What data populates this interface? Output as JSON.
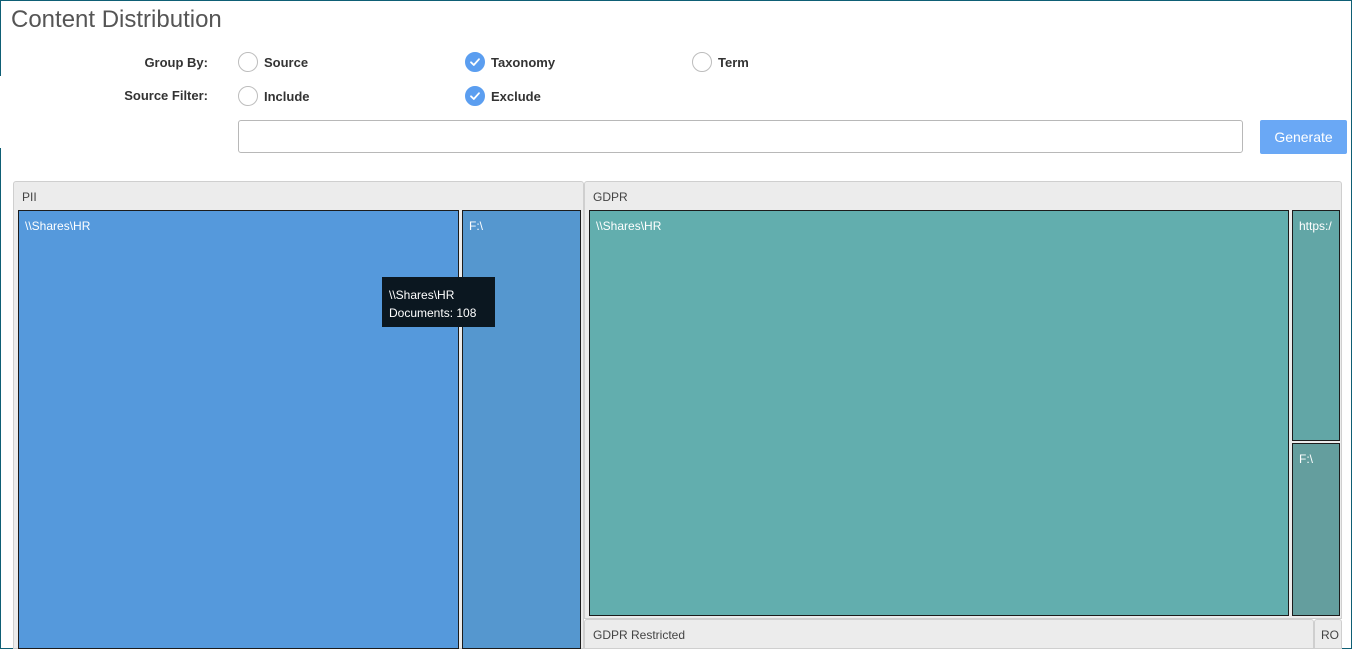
{
  "page": {
    "title": "Content Distribution"
  },
  "group_by": {
    "label": "Group By:",
    "options": [
      {
        "label": "Source",
        "checked": false
      },
      {
        "label": "Taxonomy",
        "checked": true
      },
      {
        "label": "Term",
        "checked": false
      }
    ]
  },
  "source_filter": {
    "label": "Source Filter:",
    "options": [
      {
        "label": "Include",
        "checked": false
      },
      {
        "label": "Exclude",
        "checked": true
      }
    ]
  },
  "filter_input": {
    "value": "",
    "placeholder": ""
  },
  "generate_button": {
    "label": "Generate"
  },
  "treemap": {
    "groups": [
      {
        "label": "PII",
        "tiles": [
          {
            "label": "\\\\Shares\\HR",
            "color": "#5599dc"
          },
          {
            "label": "F:\\",
            "color": "#5597cf"
          }
        ]
      },
      {
        "label": "GDPR",
        "tiles": [
          {
            "label": "\\\\Shares\\HR",
            "color": "#62aeae"
          },
          {
            "label": "https:/",
            "color": "#62a6a6"
          },
          {
            "label": "F:\\",
            "color": "#649e9e"
          }
        ]
      },
      {
        "label": "GDPR Restricted",
        "tiles": []
      },
      {
        "label": "RO",
        "tiles": []
      }
    ],
    "tooltip": {
      "title": "\\\\Shares\\HR",
      "detail": "Documents: 108"
    }
  },
  "colors": {
    "accent": "#5b9ef0",
    "button": "#6aa8f5",
    "frame": "#0e5f75"
  }
}
